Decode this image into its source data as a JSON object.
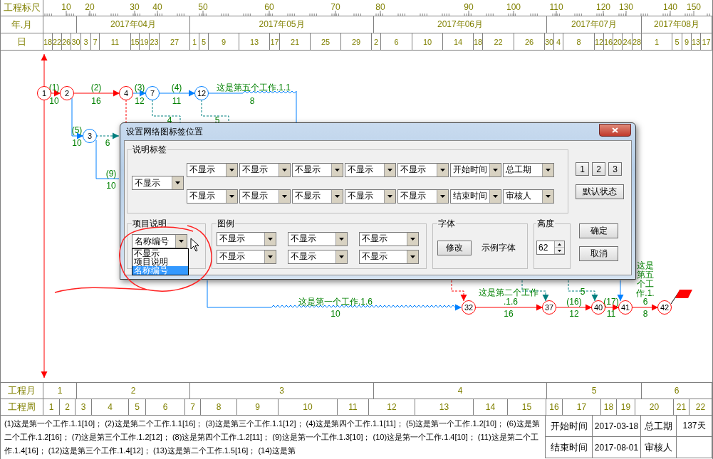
{
  "ruler": {
    "label": "工程标尺",
    "ticks": [
      "10",
      "20",
      "30",
      "40",
      "50",
      "60",
      "70",
      "80",
      "90",
      "100",
      "110",
      "120",
      "130",
      "140",
      "150"
    ]
  },
  "months": {
    "label": "年.月",
    "cells": [
      "2017年04月",
      "2017年05月",
      "2017年06月",
      "2017年07月",
      "2017年08月"
    ]
  },
  "days": {
    "label": "日",
    "cells": [
      "18",
      "22",
      "26",
      "30",
      "3",
      "7",
      "11",
      "15",
      "19",
      "23",
      "27",
      "1",
      "5",
      "9",
      "13",
      "17",
      "21",
      "25",
      "29",
      "2",
      "6",
      "10",
      "14",
      "18",
      "22",
      "26",
      "30",
      "4",
      "8",
      "12",
      "16",
      "20",
      "24",
      "28",
      "1",
      "5",
      "9",
      "13",
      "17"
    ]
  },
  "network": {
    "nodes": [
      {
        "number": "1",
        "color": "#ff0000"
      },
      {
        "number": "2",
        "color": "#ff0000"
      },
      {
        "number": "4",
        "color": "#ff0000"
      },
      {
        "number": "7",
        "color": "#0080ff"
      },
      {
        "number": "12",
        "color": "#0080ff"
      },
      {
        "number": "3",
        "color": "#0080ff"
      },
      {
        "number": "32",
        "color": "#ff0000"
      },
      {
        "number": "37",
        "color": "#ff0000"
      },
      {
        "number": "40",
        "color": "#ff0000"
      },
      {
        "number": "41",
        "color": "#ff0000"
      },
      {
        "number": "42",
        "color": "#ff0000"
      }
    ],
    "labels": [
      "(1)",
      "10",
      "(2)",
      "16",
      "(3)",
      "12",
      "(4)",
      "11",
      "这是第五个工作.1.1",
      "8",
      "(5)",
      "10",
      "6",
      "4",
      "5",
      "(9)",
      "10",
      "这是第一个工作.1.6",
      "10",
      "这是第二个工作",
      ".1.6",
      "16",
      "(16)",
      "12",
      "(17)",
      "11",
      "5",
      "这是",
      "第五",
      "个工",
      "作.1.",
      "6",
      "8"
    ]
  },
  "dialog": {
    "title": "设置网络图标签位置",
    "label_group": {
      "title": "说明标签",
      "left": "不显示",
      "row_1": [
        "不显示",
        "不显示",
        "不显示",
        "不显示",
        "不显示",
        "开始时间",
        "总工期"
      ],
      "row_2": [
        "不显示",
        "不显示",
        "不显示",
        "不显示",
        "不显示",
        "结束时间",
        "审核人"
      ]
    },
    "preset_buttons": [
      "1",
      "2",
      "3"
    ],
    "default_button": "默认状态",
    "project_group": {
      "title": "项目说明",
      "value": "名称编号",
      "options": [
        {
          "label": "不显示",
          "selected": false
        },
        {
          "label": "项目说明",
          "selected": false
        },
        {
          "label": "名称编号",
          "selected": true
        }
      ]
    },
    "legend_group": {
      "title": "图例",
      "row_1": [
        "不显示",
        "不显示",
        "不显示"
      ],
      "row_2": [
        "不显示",
        "不显示",
        "不显示"
      ]
    },
    "font_group": {
      "title": "字体",
      "button": "修改",
      "sample": "示例字体"
    },
    "height_group": {
      "title": "高度",
      "value": "62"
    },
    "ok": "确定",
    "cancel": "取消"
  },
  "project_months": {
    "label": "工程月",
    "cells": [
      "1",
      "2",
      "3",
      "4",
      "5",
      "6"
    ]
  },
  "project_weeks": {
    "label": "工程周",
    "cells": [
      "1",
      "2",
      "3",
      "4",
      "5",
      "6",
      "7",
      "8",
      "9",
      "10",
      "11",
      "12",
      "13",
      "14",
      "15",
      "16",
      "17",
      "18",
      "19",
      "20",
      "21",
      "22"
    ]
  },
  "summary": {
    "text": "(1)这是第一个工作.1.1[10]； (2)这是第二个工作.1.1[16]； (3)这是第三个工作.1.1[12]； (4)这是第四个工作.1.1[11]； (5)这是第一个工作.1.2[10]； (6)这是第二个工作.1.2[16]； (7)这是第三个工作.1.2[12]； (8)这是第四个工作.1.2[11]； (9)这是第一个工作.1.3[10]； (10)这是第一个工作.1.4[10]； (11)这是第二个工作.1.4[16]； (12)这是第三个工作.1.4[12]； (13)这是第二个工作.1.5[16]； (14)这是第",
    "rows": [
      {
        "label": "开始时间",
        "value": "2017-03-18",
        "label_2": "总工期",
        "value_2": "137天"
      },
      {
        "label": "结束时间",
        "value": "2017-08-01",
        "label_2": "审核人"
      }
    ]
  }
}
